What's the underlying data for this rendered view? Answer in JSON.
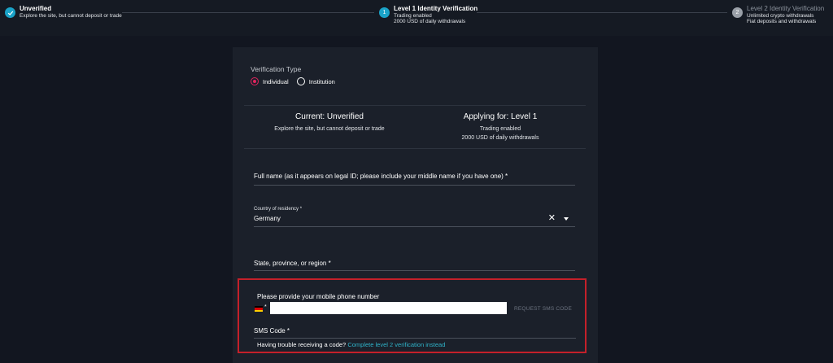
{
  "stepper": {
    "steps": [
      {
        "title": "Unverified",
        "sub1": "Explore the site, but cannot deposit or trade",
        "sub2": "",
        "state": "done",
        "icon": "check-icon"
      },
      {
        "title": "Level 1 Identity Verification",
        "sub1": "Trading enabled",
        "sub2": "2000 USD of daily withdrawals",
        "state": "active",
        "number": "1"
      },
      {
        "title": "Level 2 Identity Verification",
        "sub1": "Unlimited crypto withdrawals",
        "sub2": "Fiat deposits and withdrawals",
        "state": "todo",
        "number": "2"
      }
    ]
  },
  "form": {
    "verification_type_label": "Verification Type",
    "options": [
      {
        "label": "Individual",
        "checked": true
      },
      {
        "label": "Institution",
        "checked": false
      }
    ],
    "current": {
      "title": "Current: Unverified",
      "sub": "Explore the site, but cannot deposit or trade"
    },
    "applying": {
      "title": "Applying for: Level 1",
      "sub1": "Trading enabled",
      "sub2": "2000 USD of daily withdrawals"
    },
    "full_name_placeholder": "Full name (as it appears on legal ID; please include your middle name if you have one) *",
    "country_label": "Country of residency *",
    "country_value": "Germany",
    "state_placeholder": "State, province, or region *",
    "phone_label": "Please provide your mobile phone number",
    "phone_required": "*",
    "request_sms_label": "REQUEST SMS CODE",
    "sms_label": "SMS Code *",
    "trouble_text": "Having trouble receiving a code?",
    "trouble_link": "Complete level 2 verification instead"
  },
  "colors": {
    "accent": "#1aa3c8",
    "radio_selected": "#e0245e",
    "highlight_border": "#c4202a",
    "link": "#2fb3c9"
  }
}
